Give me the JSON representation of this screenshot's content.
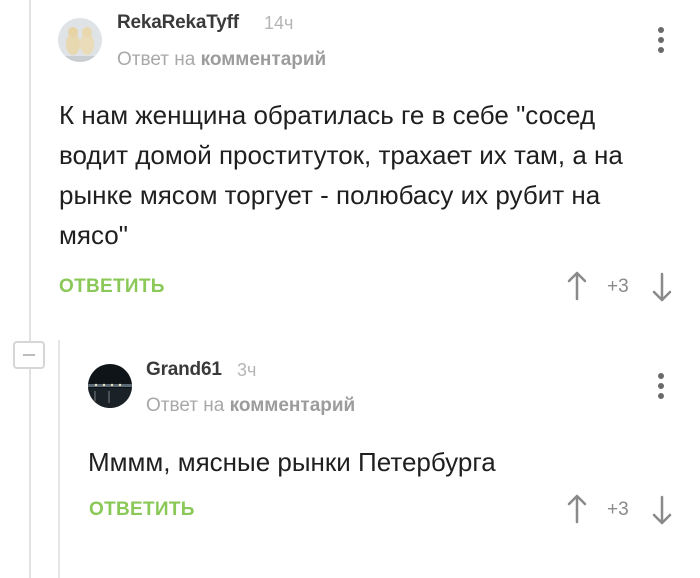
{
  "comments": [
    {
      "author": "RekaRekaTyff",
      "time": "14ч",
      "reply_to_prefix": "Ответ на",
      "reply_to_link": "комментарий",
      "body": "К нам женщина обратилась ге в себе \"сосед водит домой проституток, трахает их там, а на рынке мясом торгует - полюбасу их рубит на мясо\"",
      "reply_label": "ОТВЕТИТЬ",
      "score": "+3"
    },
    {
      "author": "Grand61",
      "time": "3ч",
      "reply_to_prefix": "Ответ на",
      "reply_to_link": "комментарий",
      "body": "Мммм, мясные рынки Петербурга",
      "reply_label": "ОТВЕТИТЬ",
      "score": "+3"
    }
  ],
  "icons": {
    "upvote": "arrow-up-icon",
    "downvote": "arrow-down-icon",
    "more": "more-vertical-icon",
    "collapse": "collapse-minus-icon"
  },
  "colors": {
    "reply_green": "#8ac858",
    "muted_gray": "#a8a8a8",
    "thread_line": "#e2e2e2"
  }
}
